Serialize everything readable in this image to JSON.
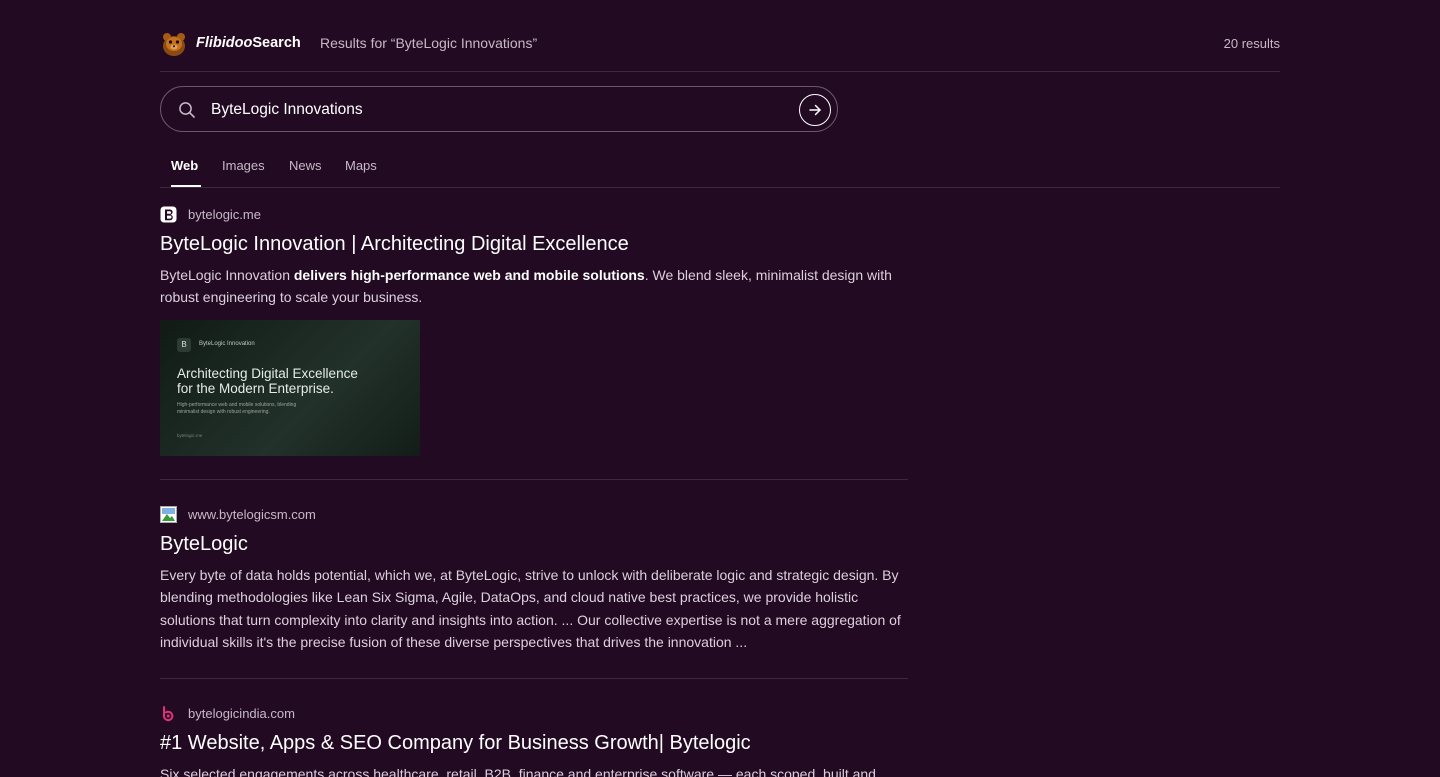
{
  "header": {
    "brand_part1": "Flibidoo",
    "brand_part2": "Search",
    "results_for": "Results for “ByteLogic Innovations”",
    "results_count": "20 results"
  },
  "search": {
    "query": "ByteLogic Innovations",
    "icon": "search-icon",
    "submit_icon": "arrow-right-icon"
  },
  "tabs": [
    {
      "label": "Web",
      "active": true
    },
    {
      "label": "Images",
      "active": false
    },
    {
      "label": "News",
      "active": false
    },
    {
      "label": "Maps",
      "active": false
    }
  ],
  "results": [
    {
      "site": "bytelogic.me",
      "title": "ByteLogic Innovation | Architecting Digital Excellence",
      "snippet_pre": "ByteLogic Innovation ",
      "snippet_bold": "delivers high-performance web and mobile solutions",
      "snippet_post": ". We blend sleek, minimalist design with robust engineering to scale your business.",
      "thumbnail": {
        "logo_letter": "B",
        "brand": "ByteLogic Innovation",
        "headline_1": "Architecting Digital Excellence",
        "headline_2": "for the Modern Enterprise.",
        "sub_1": "High-performance web and mobile solutions, blending",
        "sub_2": "minimalist design with robust engineering.",
        "footer": "bytelogic.me"
      }
    },
    {
      "site": "www.bytelogicsm.com",
      "title": "ByteLogic",
      "snippet": "Every byte of data holds potential, which we, at ByteLogic, strive to unlock with deliberate logic and strategic design. By blending methodologies like Lean Six Sigma, Agile, DataOps, and cloud native best practices, we provide holistic solutions that turn complexity into clarity and insights into action. ... Our collective expertise is not a mere aggregation of individual skills it's the precise fusion of these diverse perspectives that drives the innovation ..."
    },
    {
      "site": "bytelogicindia.com",
      "title": "#1 Website, Apps & SEO Company for Business Growth| Bytelogic",
      "snippet": "Six selected engagements across healthcare, retail, B2B, finance and enterprise software — each scoped, built and"
    }
  ],
  "colors": {
    "background": "#220b22",
    "divider": "#3c2a3c",
    "favicon_accent": "#e0327a"
  }
}
